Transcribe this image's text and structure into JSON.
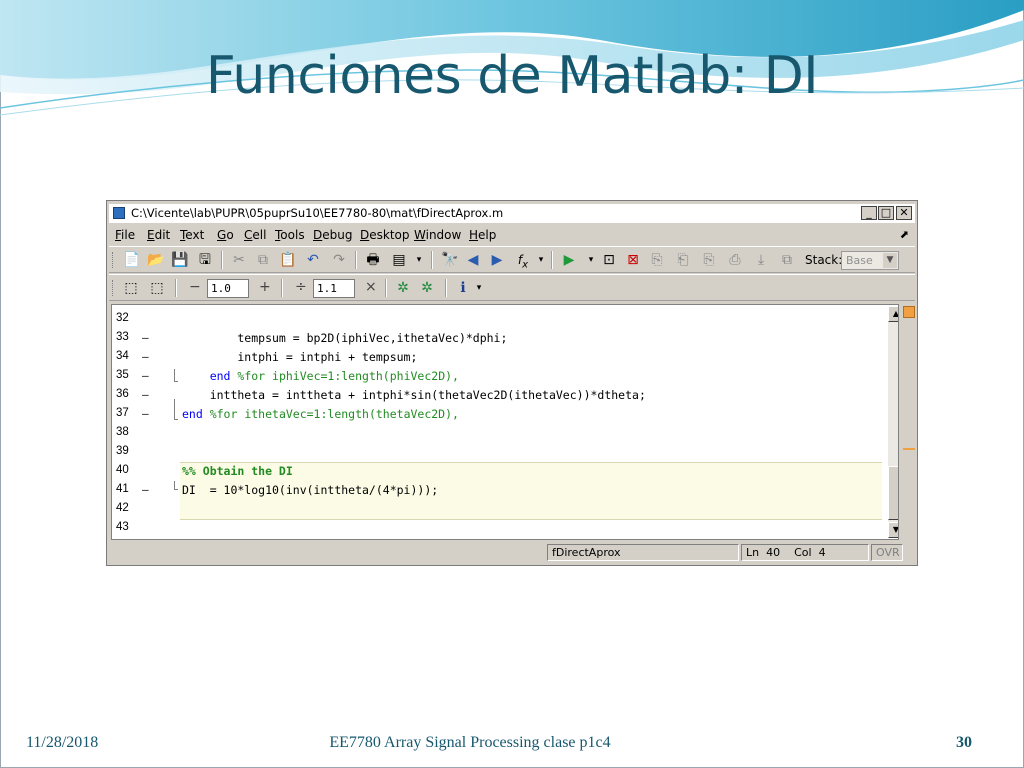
{
  "slide": {
    "title": "Funciones de Matlab: DI",
    "footer_date": "11/28/2018",
    "footer_center": "EE7780 Array Signal Processing clase p1c4",
    "page_number": "30"
  },
  "window": {
    "title": "C:\\Vicente\\lab\\PUPR\\05puprSu10\\EE7780-80\\mat\\fDirectAprox.m",
    "minimize": "_",
    "maximize": "□",
    "close": "✕"
  },
  "menu": [
    "File",
    "Edit",
    "Text",
    "Go",
    "Cell",
    "Tools",
    "Debug",
    "Desktop",
    "Window",
    "Help"
  ],
  "toolbar": {
    "stack_label": "Stack:",
    "stack_value": "Base",
    "cell_minus": "−",
    "cell_value_1": "1.0",
    "cell_plus": "+",
    "cell_divide": "÷",
    "cell_value_2": "1.1",
    "cell_times": "×"
  },
  "editor": {
    "lines": [
      {
        "num": "32",
        "dash": "",
        "code": ""
      },
      {
        "num": "33",
        "dash": "–",
        "code": "        tempsum = bp2D(iphiVec,ithetaVec)*dphi;"
      },
      {
        "num": "34",
        "dash": "–",
        "code": "        intphi = intphi + tempsum;"
      },
      {
        "num": "35",
        "dash": "–",
        "kw": "end",
        "indent": "    ",
        "comment": " %for iphiVec=1:length(phiVec2D),"
      },
      {
        "num": "36",
        "dash": "–",
        "code": "    inttheta = inttheta + intphi*sin(thetaVec2D(ithetaVec))*dtheta;"
      },
      {
        "num": "37",
        "dash": "–",
        "kw": "end",
        "indent": "",
        "comment": " %for ithetaVec=1:length(thetaVec2D),"
      },
      {
        "num": "38",
        "dash": "",
        "code": ""
      },
      {
        "num": "39",
        "dash": "",
        "code": ""
      },
      {
        "num": "40",
        "dash": "",
        "cell": "%% Obtain the DI"
      },
      {
        "num": "41",
        "dash": "–",
        "code": "DI  = 10*log10(inv(inttheta/(4*pi)));"
      },
      {
        "num": "42",
        "dash": "",
        "code": ""
      },
      {
        "num": "43",
        "dash": "",
        "code": ""
      }
    ]
  },
  "status": {
    "file": "fDirectAprox",
    "ln_label": "Ln",
    "ln_value": "40",
    "col_label": "Col",
    "col_value": "4",
    "ovr": "OVR"
  },
  "colors": {
    "title": "#17586e",
    "keyword": "#0000ff",
    "comment": "#228b22",
    "cell_bg": "#fbfbe6"
  }
}
